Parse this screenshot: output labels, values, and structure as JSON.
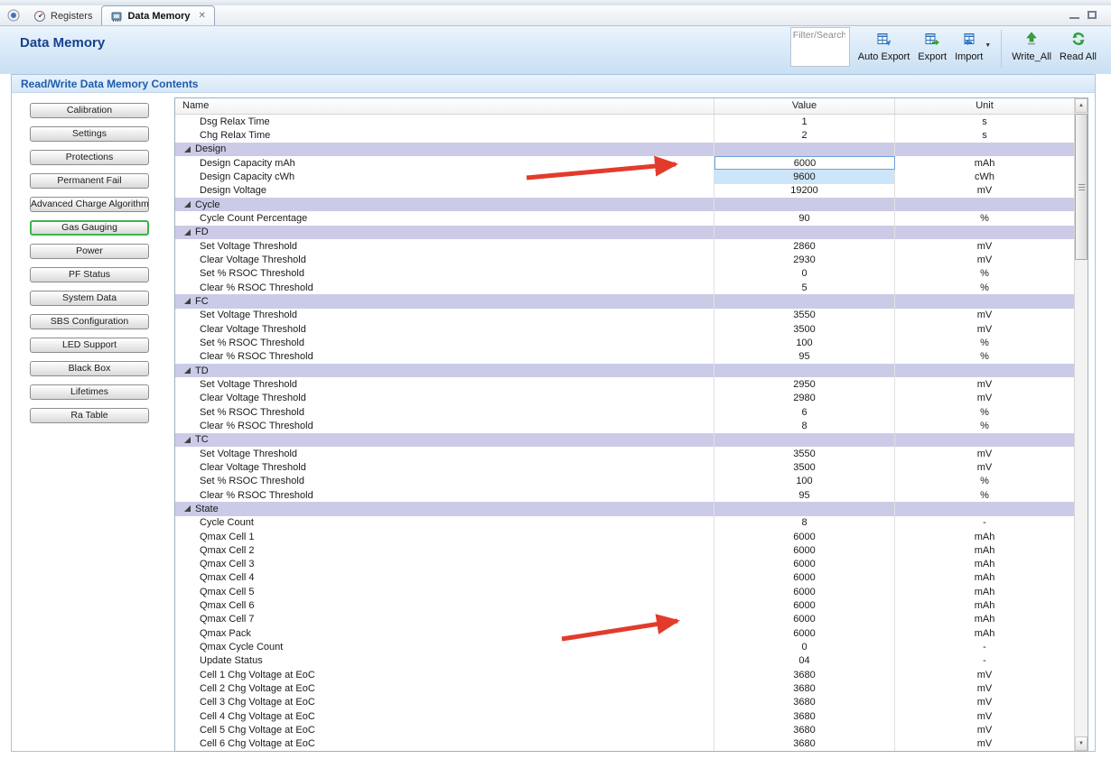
{
  "tabs": [
    {
      "label": "Registers"
    },
    {
      "label": "Data Memory"
    }
  ],
  "icons": {
    "close_tab": "✕",
    "dropdown": "▼",
    "scroll_up": "▲",
    "scroll_down": "▼"
  },
  "header": {
    "title": "Data Memory"
  },
  "toolbar": {
    "filter_placeholder": "Filter/Search",
    "buttons": [
      {
        "label": "Auto Export"
      },
      {
        "label": "Export"
      },
      {
        "label": "Import"
      },
      {
        "label": "Write_All"
      },
      {
        "label": "Read All"
      }
    ]
  },
  "section": {
    "title": "Read/Write Data Memory Contents"
  },
  "sidebar": {
    "active": "Gas Gauging",
    "items": [
      "Calibration",
      "Settings",
      "Protections",
      "Permanent Fail",
      "Advanced Charge Algorithm",
      "Gas Gauging",
      "Power",
      "PF Status",
      "System Data",
      "SBS Configuration",
      "LED Support",
      "Black Box",
      "Lifetimes",
      "Ra Table"
    ]
  },
  "table": {
    "columns": [
      "Name",
      "Value",
      "Unit"
    ],
    "rows": [
      {
        "type": "data",
        "name": "Dsg Relax Time",
        "value": "1",
        "unit": "s"
      },
      {
        "type": "data",
        "name": "Chg Relax Time",
        "value": "2",
        "unit": "s"
      },
      {
        "type": "category",
        "name": "Design"
      },
      {
        "type": "data",
        "name": "Design Capacity mAh",
        "value": "6000",
        "unit": "mAh",
        "selected": true
      },
      {
        "type": "data",
        "name": "Design Capacity cWh",
        "value": "9600",
        "unit": "cWh",
        "changed": true
      },
      {
        "type": "data",
        "name": "Design Voltage",
        "value": "19200",
        "unit": "mV"
      },
      {
        "type": "category",
        "name": "Cycle"
      },
      {
        "type": "data",
        "name": "Cycle Count Percentage",
        "value": "90",
        "unit": "%"
      },
      {
        "type": "category",
        "name": "FD"
      },
      {
        "type": "data",
        "name": "Set Voltage Threshold",
        "value": "2860",
        "unit": "mV"
      },
      {
        "type": "data",
        "name": "Clear Voltage Threshold",
        "value": "2930",
        "unit": "mV"
      },
      {
        "type": "data",
        "name": "Set % RSOC Threshold",
        "value": "0",
        "unit": "%"
      },
      {
        "type": "data",
        "name": "Clear % RSOC Threshold",
        "value": "5",
        "unit": "%"
      },
      {
        "type": "category",
        "name": "FC"
      },
      {
        "type": "data",
        "name": "Set Voltage Threshold",
        "value": "3550",
        "unit": "mV"
      },
      {
        "type": "data",
        "name": "Clear Voltage Threshold",
        "value": "3500",
        "unit": "mV"
      },
      {
        "type": "data",
        "name": "Set % RSOC Threshold",
        "value": "100",
        "unit": "%"
      },
      {
        "type": "data",
        "name": "Clear % RSOC Threshold",
        "value": "95",
        "unit": "%"
      },
      {
        "type": "category",
        "name": "TD"
      },
      {
        "type": "data",
        "name": "Set Voltage Threshold",
        "value": "2950",
        "unit": "mV"
      },
      {
        "type": "data",
        "name": "Clear Voltage Threshold",
        "value": "2980",
        "unit": "mV"
      },
      {
        "type": "data",
        "name": "Set % RSOC Threshold",
        "value": "6",
        "unit": "%"
      },
      {
        "type": "data",
        "name": "Clear % RSOC Threshold",
        "value": "8",
        "unit": "%"
      },
      {
        "type": "category",
        "name": "TC"
      },
      {
        "type": "data",
        "name": "Set Voltage Threshold",
        "value": "3550",
        "unit": "mV"
      },
      {
        "type": "data",
        "name": "Clear Voltage Threshold",
        "value": "3500",
        "unit": "mV"
      },
      {
        "type": "data",
        "name": "Set % RSOC Threshold",
        "value": "100",
        "unit": "%"
      },
      {
        "type": "data",
        "name": "Clear % RSOC Threshold",
        "value": "95",
        "unit": "%"
      },
      {
        "type": "category",
        "name": "State"
      },
      {
        "type": "data",
        "name": "Cycle Count",
        "value": "8",
        "unit": "-"
      },
      {
        "type": "data",
        "name": "Qmax Cell 1",
        "value": "6000",
        "unit": "mAh"
      },
      {
        "type": "data",
        "name": "Qmax Cell 2",
        "value": "6000",
        "unit": "mAh"
      },
      {
        "type": "data",
        "name": "Qmax Cell 3",
        "value": "6000",
        "unit": "mAh"
      },
      {
        "type": "data",
        "name": "Qmax Cell 4",
        "value": "6000",
        "unit": "mAh"
      },
      {
        "type": "data",
        "name": "Qmax Cell 5",
        "value": "6000",
        "unit": "mAh"
      },
      {
        "type": "data",
        "name": "Qmax Cell 6",
        "value": "6000",
        "unit": "mAh"
      },
      {
        "type": "data",
        "name": "Qmax Cell 7",
        "value": "6000",
        "unit": "mAh"
      },
      {
        "type": "data",
        "name": "Qmax Pack",
        "value": "6000",
        "unit": "mAh"
      },
      {
        "type": "data",
        "name": "Qmax Cycle Count",
        "value": "0",
        "unit": "-"
      },
      {
        "type": "data",
        "name": "Update Status",
        "value": "04",
        "unit": "-"
      },
      {
        "type": "data",
        "name": "Cell 1 Chg Voltage at EoC",
        "value": "3680",
        "unit": "mV"
      },
      {
        "type": "data",
        "name": "Cell 2 Chg Voltage at EoC",
        "value": "3680",
        "unit": "mV"
      },
      {
        "type": "data",
        "name": "Cell 3 Chg Voltage at EoC",
        "value": "3680",
        "unit": "mV"
      },
      {
        "type": "data",
        "name": "Cell 4 Chg Voltage at EoC",
        "value": "3680",
        "unit": "mV"
      },
      {
        "type": "data",
        "name": "Cell 5 Chg Voltage at EoC",
        "value": "3680",
        "unit": "mV"
      },
      {
        "type": "data",
        "name": "Cell 6 Chg Voltage at EoC",
        "value": "3680",
        "unit": "mV"
      }
    ]
  },
  "colors": {
    "annotation_arrow": "#e23b2c",
    "active_nav_border": "#3cb54a",
    "category_row_bg": "#cbcbe8",
    "changed_cell_bg": "#cde5f8",
    "title_blue": "#17418c",
    "section_blue": "#1e5cab"
  }
}
